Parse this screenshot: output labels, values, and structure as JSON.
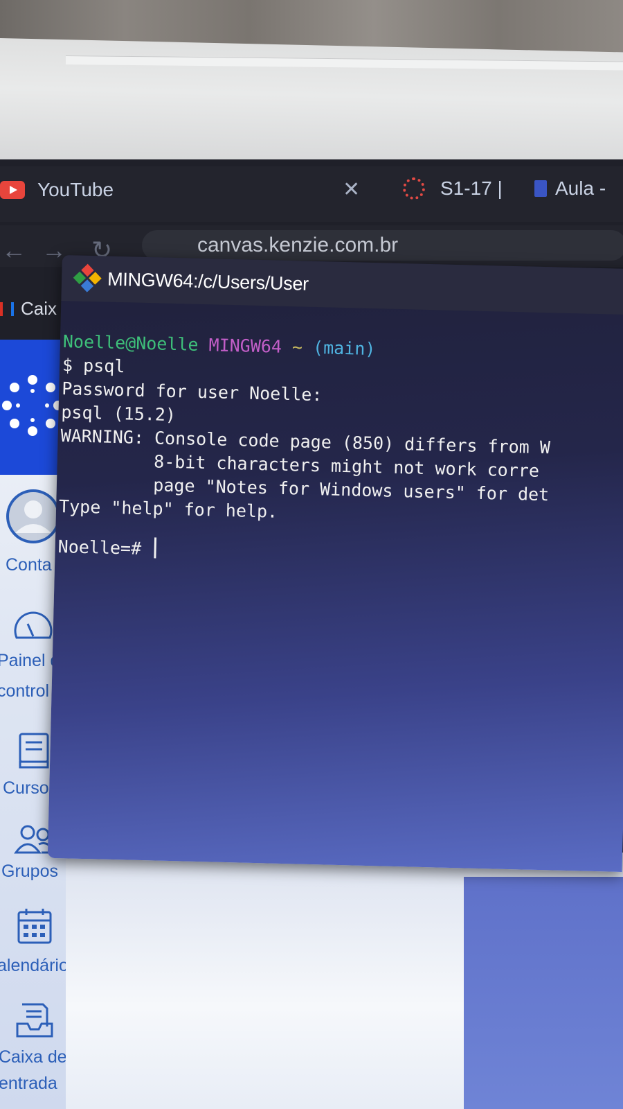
{
  "browser": {
    "tabs": [
      {
        "label": "YouTube",
        "icon": "youtube-icon"
      },
      {
        "label": "S1-17 |",
        "icon": "loading-spinner-icon"
      },
      {
        "label": "Aula -",
        "icon": "document-icon"
      }
    ],
    "close_glyph": "✕",
    "url": "canvas.kenzie.com.br",
    "bookmark": "Caix"
  },
  "terminal": {
    "title": "MINGW64:/c/Users/User",
    "prompt": {
      "user_host": "Noelle@Noelle",
      "system": "MINGW64",
      "path": "~",
      "branch": "(main)"
    },
    "lines": [
      "$ psql",
      "Password for user Noelle:",
      "psql (15.2)",
      "WARNING: Console code page (850) differs from W",
      "         8-bit characters might not work corre",
      "         page \"Notes for Windows users\" for det",
      "Type \"help\" for help.",
      "",
      "Noelle=# "
    ]
  },
  "sidebar": {
    "items": [
      {
        "label": "Conta",
        "icon": "user-avatar-icon"
      },
      {
        "label": "Painel de\ncontrole",
        "label_lines": [
          "Painel d",
          "control"
        ],
        "icon": "dashboard-gauge-icon"
      },
      {
        "label": "Cursos",
        "icon": "book-icon"
      },
      {
        "label": "Grupos",
        "icon": "users-group-icon"
      },
      {
        "label": "alendário",
        "icon": "calendar-icon"
      },
      {
        "label_lines": [
          "Caixa de",
          "entrada"
        ],
        "icon": "inbox-icon"
      }
    ]
  },
  "colors": {
    "canvas_blue": "#1c49d8",
    "prompt_green": "#3ec07a",
    "prompt_magenta": "#c35ec8",
    "prompt_cyan": "#4fb3e0"
  }
}
